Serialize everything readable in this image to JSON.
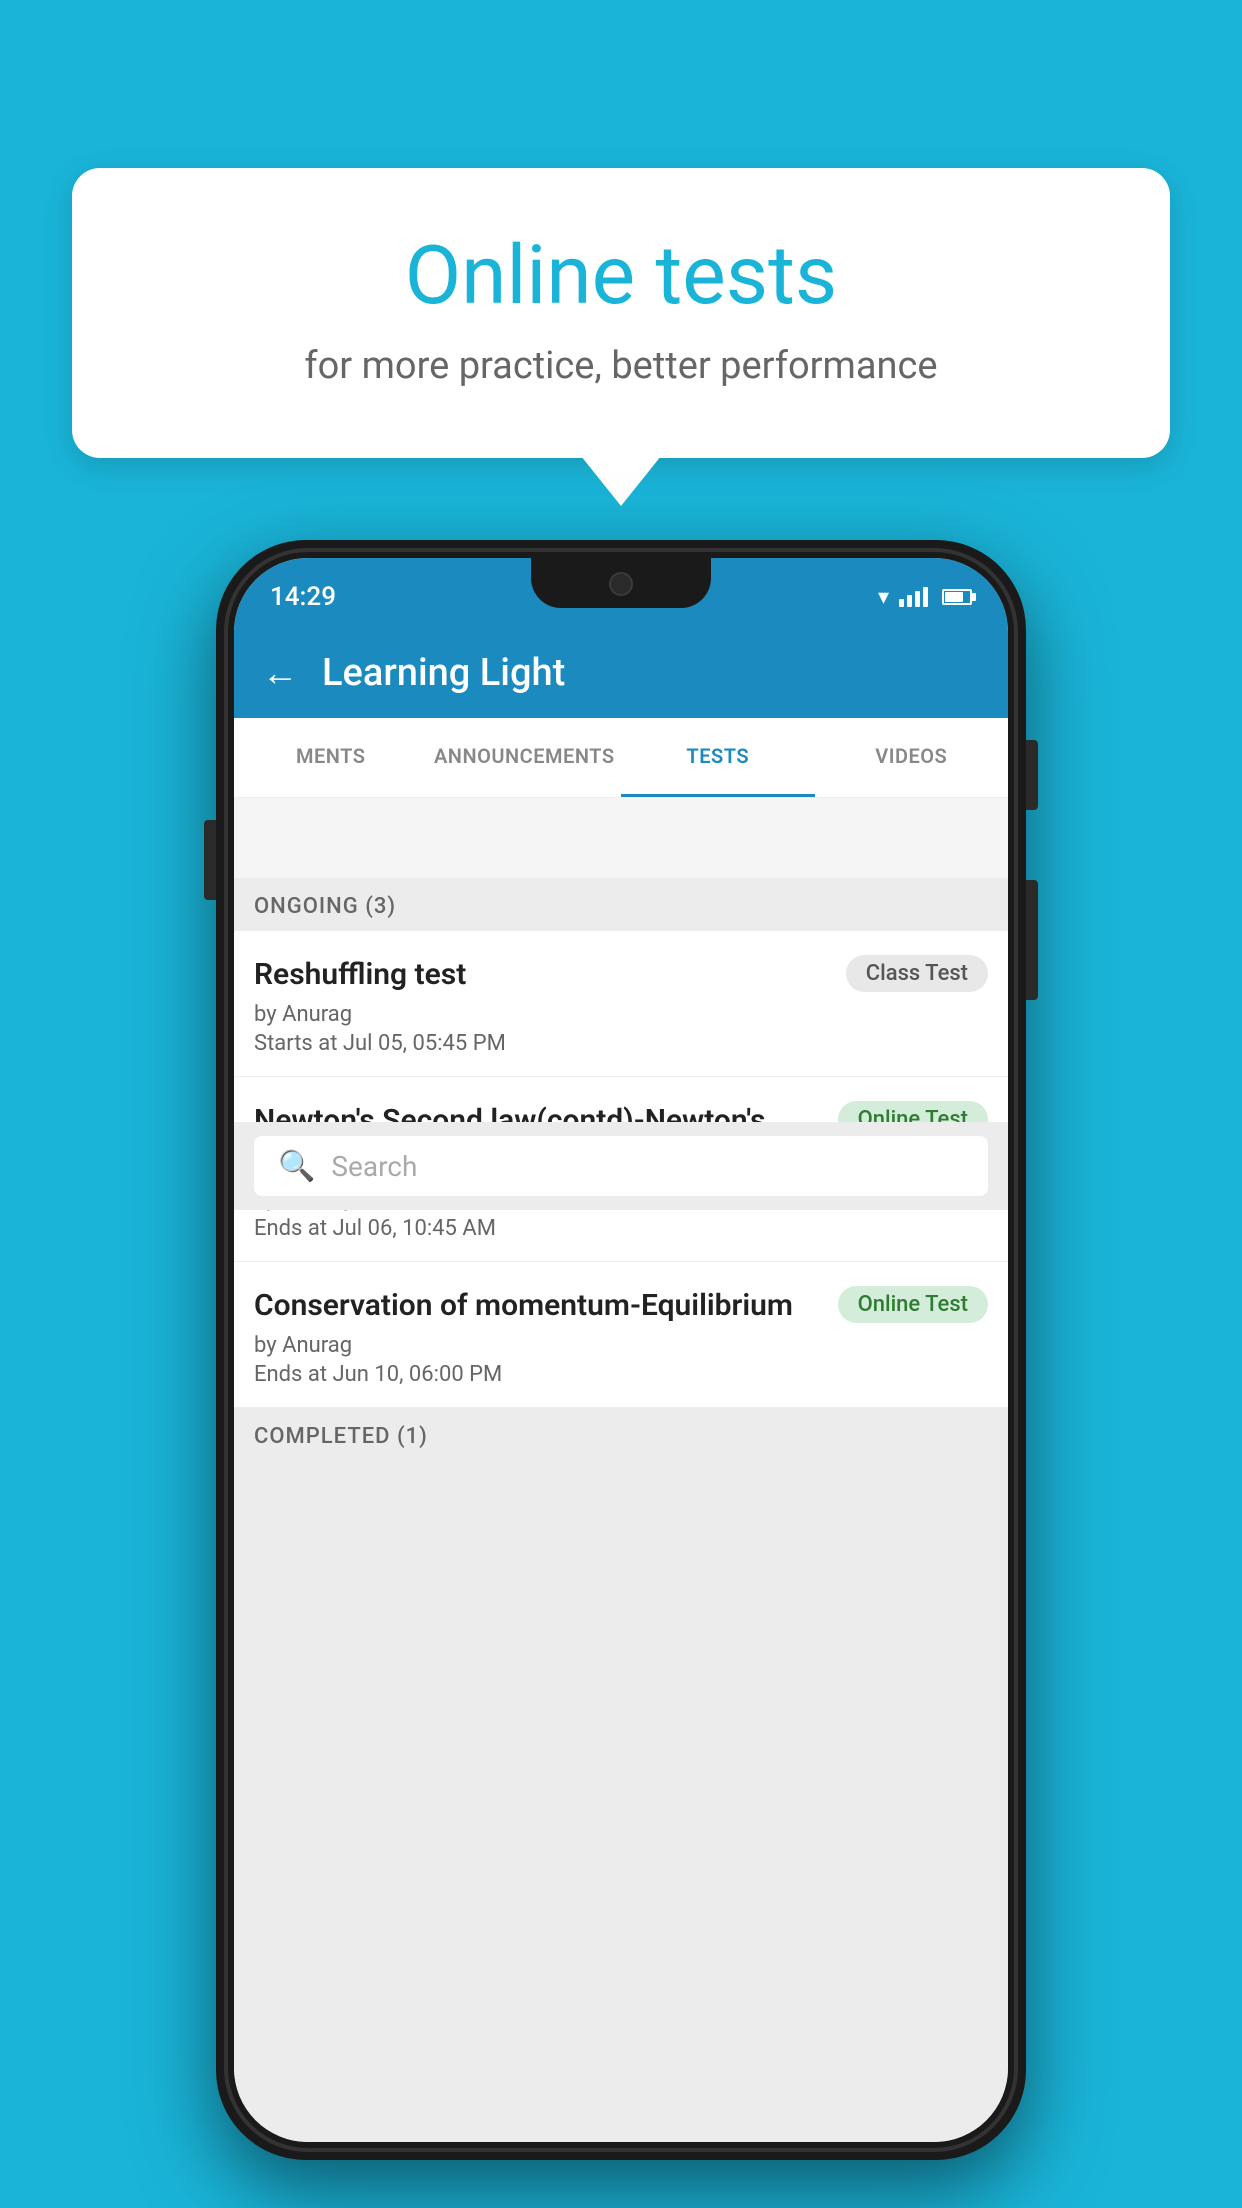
{
  "background_color": "#1ab4d8",
  "speech_bubble": {
    "title": "Online tests",
    "subtitle": "for more practice, better performance"
  },
  "status_bar": {
    "time": "14:29"
  },
  "app_bar": {
    "title": "Learning Light",
    "back_label": "←"
  },
  "tabs": [
    {
      "label": "MENTS",
      "active": false
    },
    {
      "label": "ANNOUNCEMENTS",
      "active": false
    },
    {
      "label": "TESTS",
      "active": true
    },
    {
      "label": "VIDEOS",
      "active": false
    }
  ],
  "search": {
    "placeholder": "Search"
  },
  "ongoing_section": {
    "label": "ONGOING (3)"
  },
  "tests": [
    {
      "title": "Reshuffling test",
      "badge": "Class Test",
      "badge_type": "class",
      "by": "by Anurag",
      "time_label": "Starts at",
      "time": "Jul 05, 05:45 PM"
    },
    {
      "title": "Newton's Second law(contd)-Newton's Thir...",
      "badge": "Online Test",
      "badge_type": "online",
      "by": "by Anurag",
      "time_label": "Ends at",
      "time": "Jul 06, 10:45 AM"
    },
    {
      "title": "Conservation of momentum-Equilibrium",
      "badge": "Online Test",
      "badge_type": "online",
      "by": "by Anurag",
      "time_label": "Ends at",
      "time": "Jun 10, 06:00 PM"
    }
  ],
  "completed_section": {
    "label": "COMPLETED (1)"
  }
}
